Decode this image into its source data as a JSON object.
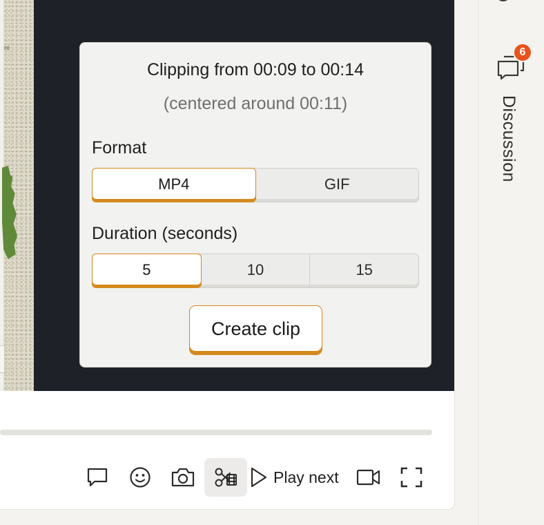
{
  "clip": {
    "title": "Clipping from 00:09 to 00:14",
    "subtitle": "(centered around 00:11)",
    "format_label": "Format",
    "formats": [
      "MP4",
      "GIF"
    ],
    "selected_format": "MP4",
    "duration_label": "Duration (seconds)",
    "durations": [
      "5",
      "10",
      "15"
    ],
    "selected_duration": "5",
    "create_button": "Create clip"
  },
  "map": {
    "label_fragment": "re"
  },
  "controls": {
    "play_next": "Play next",
    "icons": [
      "comment-icon",
      "emoji-icon",
      "camera-icon",
      "clip-scissors-icon",
      "play-icon",
      "video-camera-icon",
      "fullscreen-icon"
    ]
  },
  "sidebar": {
    "top_tab_fragment": "lip",
    "discussion_label": "Discussion",
    "discussion_badge": "6"
  },
  "colors": {
    "accent": "#d4891d",
    "badge": "#e8541d",
    "video_bg": "#1e2127"
  }
}
